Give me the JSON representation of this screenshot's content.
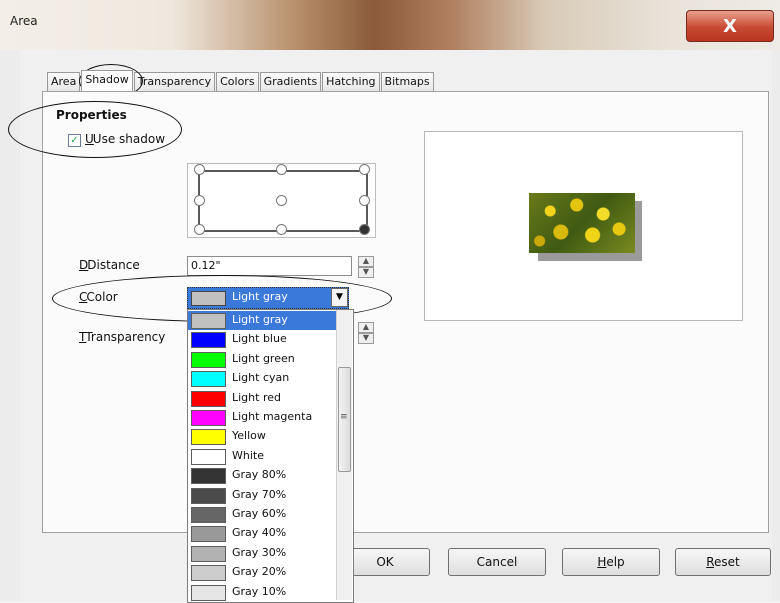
{
  "window": {
    "title": "Area",
    "close_glyph": "X"
  },
  "tabs": [
    "Area",
    "Shadow",
    "Transparency",
    "Colors",
    "Gradients",
    "Hatching",
    "Bitmaps"
  ],
  "active_tab": "Shadow",
  "properties": {
    "heading": "Properties",
    "use_shadow_label": "Use shadow",
    "use_shadow_checked": true
  },
  "distance": {
    "label": "Distance",
    "value": "0.12\""
  },
  "color": {
    "label": "Color",
    "selected": "Light gray"
  },
  "transparency": {
    "label": "Transparency"
  },
  "color_list": [
    {
      "name": "Light gray",
      "swatch": "#c0c0c0"
    },
    {
      "name": "Light blue",
      "swatch": "#0000ff"
    },
    {
      "name": "Light green",
      "swatch": "#00ff00"
    },
    {
      "name": "Light cyan",
      "swatch": "#00ffff"
    },
    {
      "name": "Light red",
      "swatch": "#ff0000"
    },
    {
      "name": "Light magenta",
      "swatch": "#ff00ff"
    },
    {
      "name": "Yellow",
      "swatch": "#ffff00"
    },
    {
      "name": "White",
      "swatch": "#ffffff"
    },
    {
      "name": "Gray 80%",
      "swatch": "#333333"
    },
    {
      "name": "Gray 70%",
      "swatch": "#4c4c4c"
    },
    {
      "name": "Gray 60%",
      "swatch": "#666666"
    },
    {
      "name": "Gray 40%",
      "swatch": "#999999"
    },
    {
      "name": "Gray 30%",
      "swatch": "#b2b2b2"
    },
    {
      "name": "Gray 20%",
      "swatch": "#cccccc"
    },
    {
      "name": "Gray 10%",
      "swatch": "#e6e6e6"
    }
  ],
  "buttons": {
    "ok": "OK",
    "cancel": "Cancel",
    "help": "Help",
    "reset": "Reset"
  },
  "colors": {
    "selection": "#3a79d9",
    "close_button": "#c84a32"
  }
}
